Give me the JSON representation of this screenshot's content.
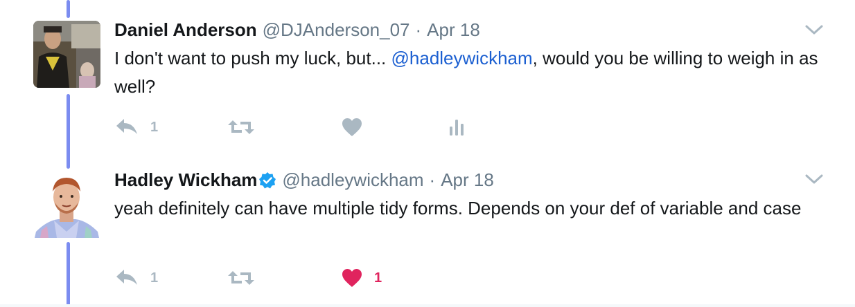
{
  "tweets": [
    {
      "name": "Daniel Anderson",
      "handle": "@DJAnderson_07",
      "separator": "·",
      "time": "Apr 18",
      "text_parts": {
        "before": "I don't want to push my luck, but... ",
        "mention": "@hadleywickham",
        "after": ", would you be willing to weigh in as well?"
      },
      "reply_count": "1",
      "retweet_count": "",
      "like_count": "",
      "liked": false,
      "verified": false
    },
    {
      "name": "Hadley Wickham",
      "handle": "@hadleywickham",
      "separator": "·",
      "time": "Apr 18",
      "text": "yeah definitely can have multiple tidy forms. Depends on your def of variable and case",
      "reply_count": "1",
      "retweet_count": "",
      "like_count": "1",
      "liked": true,
      "verified": true
    }
  ],
  "icons": {
    "reply": "reply-icon",
    "retweet": "retweet-icon",
    "like": "heart-icon",
    "analytics": "analytics-icon",
    "more": "chevron-down-icon",
    "verified": "verified-badge-icon"
  },
  "colors": {
    "thread_line": "#7b8cf0",
    "mention": "#1b5fd1",
    "muted": "#657786",
    "action_icon": "#aab8c2",
    "like_active": "#e0245e",
    "verified": "#1da1f2"
  }
}
